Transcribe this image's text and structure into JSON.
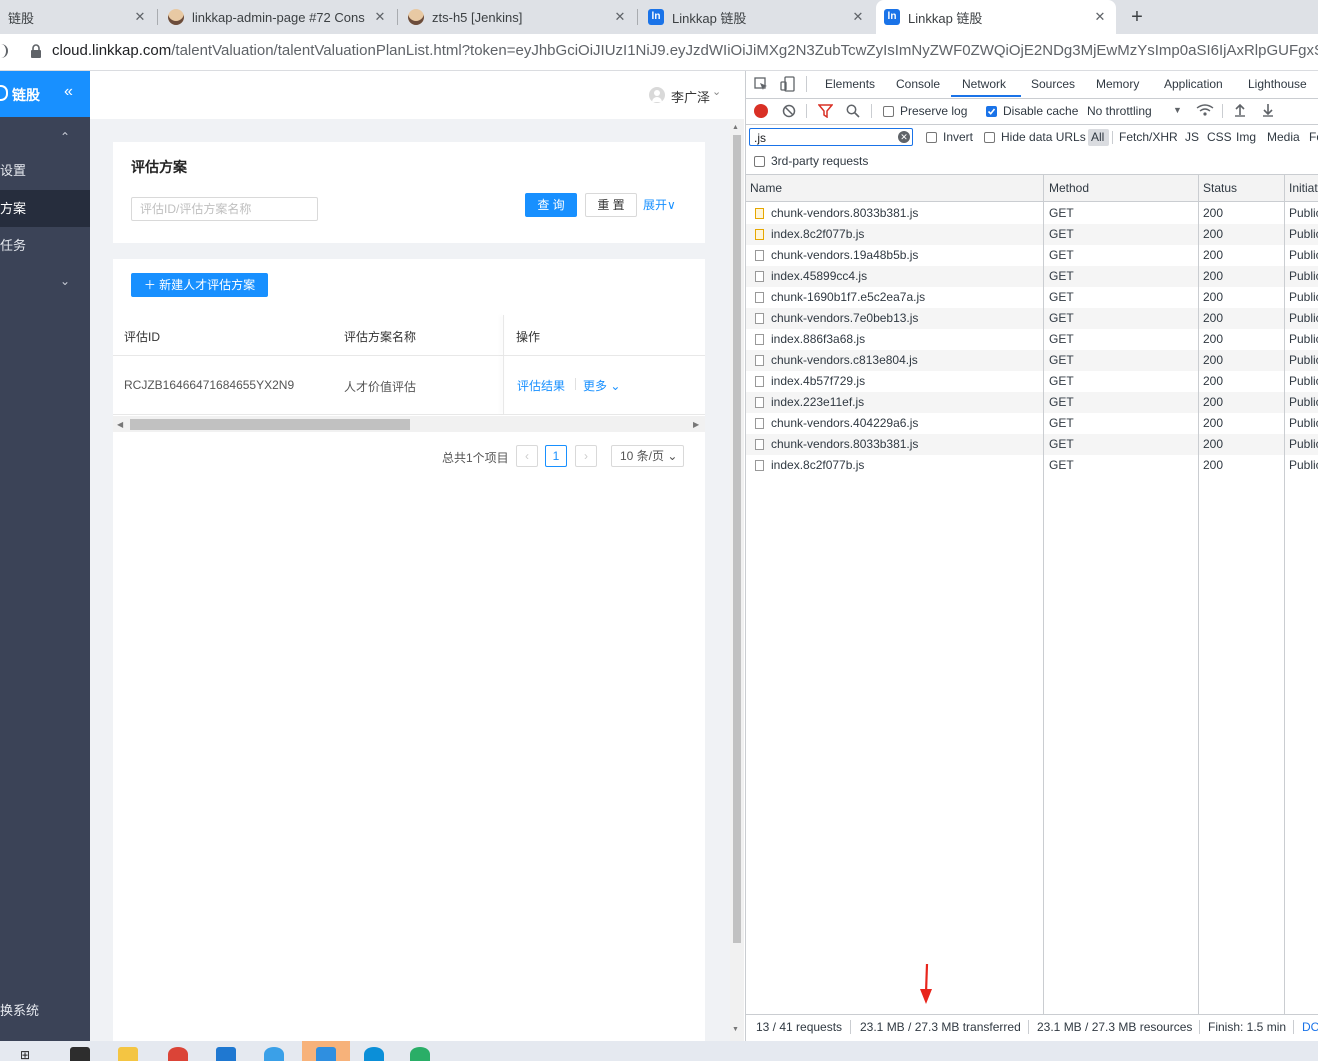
{
  "tabs": [
    {
      "title": "链股",
      "close": "✕"
    },
    {
      "title": "linkkap-admin-page #72 Cons",
      "close": "✕"
    },
    {
      "title": "zts-h5 [Jenkins]",
      "close": "✕"
    },
    {
      "title": "Linkkap 链股",
      "close": "✕"
    },
    {
      "title": "Linkkap 链股",
      "close": "✕",
      "active": true
    }
  ],
  "new_tab": "+",
  "address": {
    "host": "cloud.linkkap.com",
    "path": "/talentValuation/talentValuationPlanList.html?token=eyJhbGciOiJIUzI1NiJ9.eyJzdWIiOiJiMXg2N3ZubTcwZyIsImNyZWF0ZWQiOjE2NDg3MjEwMzYsImp0aSI6IjAxRlpGUFgxSFR"
  },
  "sidebar": {
    "logo_text": "链股",
    "collapse": "«",
    "chevron_up": "⌃",
    "items": [
      {
        "label": "设置"
      },
      {
        "label": "方案",
        "active": true
      },
      {
        "label": "任务"
      }
    ],
    "chevron_down": "⌄",
    "bottom_label": "换系统"
  },
  "header": {
    "user_name": "李广泽",
    "caret": "⌄"
  },
  "search_card": {
    "title": "评估方案",
    "search_placeholder": "评估ID/评估方案名称",
    "query_label": "查 询",
    "reset_label": "重 置",
    "expand_label": "展开∨"
  },
  "table_card": {
    "new_button": "＋ 新建人才评估方案",
    "columns": [
      "评估ID",
      "评估方案名称",
      "操作"
    ],
    "rows": [
      {
        "id": "RCJZB16466471684655YX2N9",
        "name": "人才价值评估",
        "action_result": "评估结果",
        "action_more": "更多 ⌄"
      }
    ]
  },
  "pagination": {
    "total": "总共1个项目",
    "prev": "‹",
    "current": "1",
    "next": "›",
    "page_size": "10 条/页 ⌄"
  },
  "devtools": {
    "tabs": [
      "Elements",
      "Console",
      "Network",
      "Sources",
      "Memory",
      "Application",
      "Lighthouse"
    ],
    "active_tab": "Network",
    "toolbar": {
      "preserve_log": "Preserve log",
      "disable_cache": "Disable cache",
      "throttling": "No throttling",
      "throttling_caret": "▼"
    },
    "filter": {
      "value": ".js",
      "invert": "Invert",
      "hide_data_urls": "Hide data URLs",
      "types": [
        "All",
        "Fetch/XHR",
        "JS",
        "CSS",
        "Img",
        "Media",
        "Fo"
      ],
      "third_party": "3rd-party requests"
    },
    "columns": [
      "Name",
      "Method",
      "Status",
      "Initiat"
    ],
    "requests": [
      {
        "name": "chunk-vendors.8033b381.js",
        "method": "GET",
        "status": "200",
        "initiator": "Public",
        "cached": true
      },
      {
        "name": "index.8c2f077b.js",
        "method": "GET",
        "status": "200",
        "initiator": "Public",
        "cached": true
      },
      {
        "name": "chunk-vendors.19a48b5b.js",
        "method": "GET",
        "status": "200",
        "initiator": "Public",
        "cached": false
      },
      {
        "name": "index.45899cc4.js",
        "method": "GET",
        "status": "200",
        "initiator": "Public",
        "cached": false
      },
      {
        "name": "chunk-1690b1f7.e5c2ea7a.js",
        "method": "GET",
        "status": "200",
        "initiator": "Public",
        "cached": false
      },
      {
        "name": "chunk-vendors.7e0beb13.js",
        "method": "GET",
        "status": "200",
        "initiator": "Public",
        "cached": false
      },
      {
        "name": "index.886f3a68.js",
        "method": "GET",
        "status": "200",
        "initiator": "Public",
        "cached": false
      },
      {
        "name": "chunk-vendors.c813e804.js",
        "method": "GET",
        "status": "200",
        "initiator": "Public",
        "cached": false
      },
      {
        "name": "index.4b57f729.js",
        "method": "GET",
        "status": "200",
        "initiator": "Public",
        "cached": false
      },
      {
        "name": "index.223e11ef.js",
        "method": "GET",
        "status": "200",
        "initiator": "Public",
        "cached": false
      },
      {
        "name": "chunk-vendors.404229a6.js",
        "method": "GET",
        "status": "200",
        "initiator": "Public",
        "cached": false
      },
      {
        "name": "chunk-vendors.8033b381.js",
        "method": "GET",
        "status": "200",
        "initiator": "Public",
        "cached": false
      },
      {
        "name": "index.8c2f077b.js",
        "method": "GET",
        "status": "200",
        "initiator": "Public",
        "cached": false
      }
    ],
    "status": {
      "requests": "13 / 41 requests",
      "transferred": "23.1 MB / 27.3 MB transferred",
      "resources": "23.1 MB / 27.3 MB resources",
      "finish": "Finish: 1.5 min",
      "dom": "DO"
    }
  },
  "colors": {
    "accent": "#1890ff",
    "sidebar": "#3b4357",
    "annotation_arrow": "#e8251c"
  }
}
